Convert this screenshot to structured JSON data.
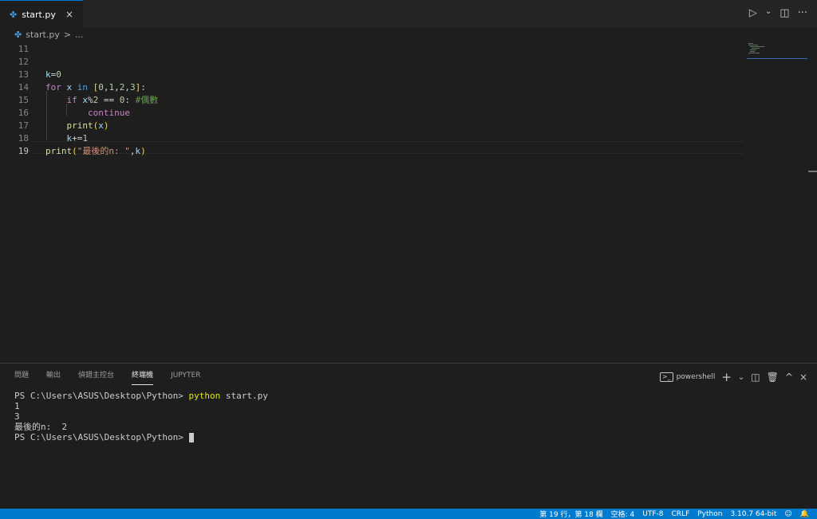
{
  "tab": {
    "icon": "python-file-icon",
    "label": "start.py",
    "close": "×"
  },
  "title_actions": {
    "run": "▷",
    "run_dropdown": "⌄",
    "split": "◫",
    "more": "···"
  },
  "breadcrumb": {
    "file": "start.py",
    "sep": ">",
    "rest": "..."
  },
  "editor": {
    "lines": [
      {
        "n": "11",
        "tokens": []
      },
      {
        "n": "12",
        "tokens": []
      },
      {
        "n": "13",
        "tokens": [
          {
            "t": "k",
            "c": "var"
          },
          {
            "t": "=",
            "c": "op"
          },
          {
            "t": "0",
            "c": "num"
          }
        ]
      },
      {
        "n": "14",
        "tokens": [
          {
            "t": "for",
            "c": "kw"
          },
          {
            "t": " ",
            "c": "op"
          },
          {
            "t": "x",
            "c": "var"
          },
          {
            "t": " ",
            "c": "op"
          },
          {
            "t": "in",
            "c": "kw2"
          },
          {
            "t": " ",
            "c": "op"
          },
          {
            "t": "[",
            "c": "br1"
          },
          {
            "t": "0",
            "c": "num"
          },
          {
            "t": ",",
            "c": "op"
          },
          {
            "t": "1",
            "c": "num"
          },
          {
            "t": ",",
            "c": "op"
          },
          {
            "t": "2",
            "c": "num"
          },
          {
            "t": ",",
            "c": "op"
          },
          {
            "t": "3",
            "c": "num"
          },
          {
            "t": "]",
            "c": "br1"
          },
          {
            "t": ":",
            "c": "op"
          }
        ]
      },
      {
        "n": "15",
        "tokens": [
          {
            "t": "    ",
            "c": "op"
          },
          {
            "t": "if",
            "c": "kw"
          },
          {
            "t": " ",
            "c": "op"
          },
          {
            "t": "x",
            "c": "var"
          },
          {
            "t": "%",
            "c": "op"
          },
          {
            "t": "2",
            "c": "num"
          },
          {
            "t": " == ",
            "c": "op"
          },
          {
            "t": "0",
            "c": "num"
          },
          {
            "t": ": ",
            "c": "op"
          },
          {
            "t": "#偶數",
            "c": "cmt"
          }
        ]
      },
      {
        "n": "16",
        "tokens": [
          {
            "t": "        ",
            "c": "op"
          },
          {
            "t": "continue",
            "c": "kw"
          }
        ]
      },
      {
        "n": "17",
        "tokens": [
          {
            "t": "    ",
            "c": "op"
          },
          {
            "t": "print",
            "c": "fn"
          },
          {
            "t": "(",
            "c": "br1"
          },
          {
            "t": "x",
            "c": "var"
          },
          {
            "t": ")",
            "c": "br1"
          }
        ]
      },
      {
        "n": "18",
        "tokens": [
          {
            "t": "    ",
            "c": "op"
          },
          {
            "t": "k",
            "c": "var"
          },
          {
            "t": "+=",
            "c": "op"
          },
          {
            "t": "1",
            "c": "num"
          }
        ]
      },
      {
        "n": "19",
        "active": true,
        "tokens": [
          {
            "t": "print",
            "c": "fn"
          },
          {
            "t": "(",
            "c": "br1"
          },
          {
            "t": "\"最後的n: \"",
            "c": "str"
          },
          {
            "t": ",",
            "c": "op"
          },
          {
            "t": "k",
            "c": "var"
          },
          {
            "t": ")",
            "c": "br1"
          }
        ]
      }
    ]
  },
  "panel": {
    "tabs": [
      "問題",
      "輸出",
      "偵錯主控台",
      "終端機",
      "JUPYTER"
    ],
    "active_tab": "終端機",
    "shell_label": "powershell",
    "actions": {
      "terminal_icon": "terminal-icon",
      "add": "+",
      "add_dropdown": "⌄",
      "split": "◫",
      "trash": "trash-icon",
      "maximize": "^",
      "close": "×"
    },
    "terminal": {
      "prompt": "PS C:\\Users\\ASUS\\Desktop\\Python> ",
      "command": "python",
      "command_args": " start.py",
      "output": [
        "1",
        "3",
        "最後的n:  2"
      ]
    }
  },
  "status": {
    "position": "第 19 行，第 18 欄",
    "spaces": "空格: 4",
    "encoding": "UTF-8",
    "eol": "CRLF",
    "language": "Python",
    "interpreter": "3.10.7 64-bit",
    "feedback_icon": "person-feedback-icon",
    "bell_icon": "bell-icon"
  },
  "colors": {
    "accent": "#007acc",
    "background": "#1e1e1e",
    "tab_bar": "#252526"
  }
}
